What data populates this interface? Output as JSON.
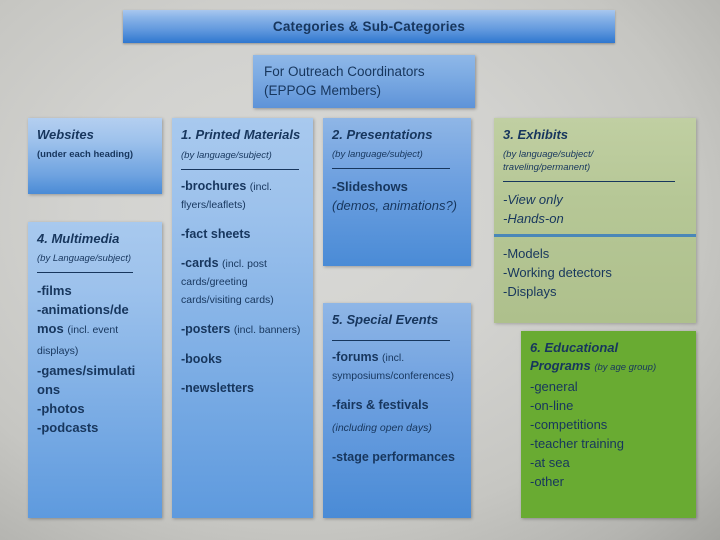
{
  "slide": {
    "title": "Categories & Sub-Categories",
    "subtitle_line1": "For Outreach Coordinators",
    "subtitle_line2": "(EPPOG Members)",
    "colors": {
      "blue_light": "#9ec2ec",
      "blue_mid": "#4a8bd6",
      "green_pale": "#b6c796",
      "green_bright": "#69ab32",
      "text": "#17365d",
      "background": "#d2d2cf",
      "divider": "#4a87b8"
    }
  },
  "panels": {
    "websites": {
      "heading": "Websites",
      "note": "(under each heading)"
    },
    "multimedia": {
      "heading": "4.  Multimedia",
      "note": "(by Language/subject)",
      "items": [
        "-films",
        "-animations/demos",
        "-games/simulations",
        "-photos",
        "-podcasts"
      ],
      "item_films": "-films",
      "item_animations": "-animations/de mos",
      "item_animations_note": "(incl. event displays)",
      "item_games": "-games/simulati ons",
      "item_photos": "-photos",
      "item_podcasts": "-podcasts"
    },
    "printed_materials": {
      "heading": "1.  Printed Materials",
      "note": "(by language/subject)",
      "item_brochures": "-brochures",
      "item_brochures_note": "(incl. flyers/leaflets)",
      "item_fact_sheets": "-fact sheets",
      "item_cards": "-cards",
      "item_cards_note": "(incl. post cards/greeting cards/visiting cards)",
      "item_posters": "-posters",
      "item_posters_note": "(incl. banners)",
      "item_books": "-books",
      "item_newsletters": "-newsletters"
    },
    "presentations": {
      "heading": "2.  Presentations",
      "note": "(by language/subject)",
      "item_slideshows": "-Slideshows",
      "item_slideshows_note": "(demos, animations?)"
    },
    "special_events": {
      "heading": "5.   Special Events",
      "item_forums": "-forums",
      "item_forums_note": "(incl. symposiums/conferences)",
      "item_fairs": "-fairs & festivals",
      "item_fairs_note": "(including open days)",
      "item_stage": "-stage performances"
    },
    "exhibits": {
      "heading": "3.  Exhibits",
      "note_line1": "(by language/subject/",
      "note_line2": "traveling/permanent)",
      "item_view_only": "-View only",
      "item_hands_on": "-Hands-on",
      "item_models": "-Models",
      "item_working_detectors": "-Working detectors",
      "item_displays": "-Displays"
    },
    "educational_programs": {
      "heading_line1": "6.  Educational",
      "heading_line2": "Programs",
      "note": "(by age group)",
      "item_general": "-general",
      "item_online": "-on-line",
      "item_competitions": "-competitions",
      "item_teacher_training": "-teacher training",
      "item_at_sea": "-at sea",
      "item_other": "-other"
    }
  }
}
